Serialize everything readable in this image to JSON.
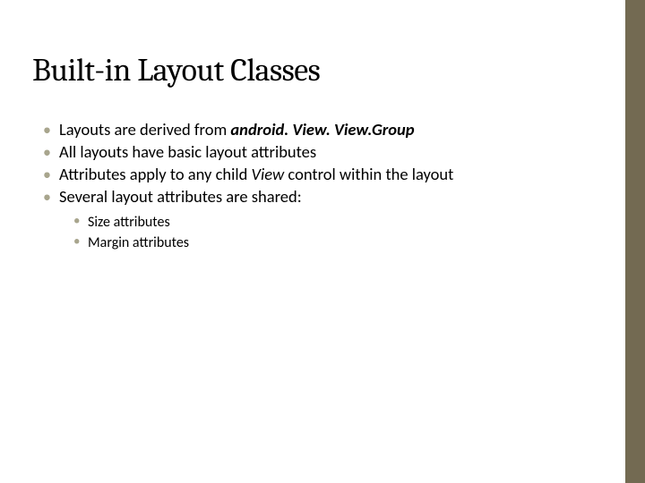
{
  "title": "Built-in Layout Classes",
  "bullets": {
    "b0pre": "Layouts are derived from ",
    "b0em": "android. View. View.Group",
    "b1": "All layouts have basic layout attributes",
    "b2pre": "Attributes apply to any child ",
    "b2em": "View",
    "b2post": " control within the layout",
    "b3": "Several layout attributes are shared:"
  },
  "subs": {
    "s0": "Size attributes",
    "s1": "Margin attributes"
  }
}
